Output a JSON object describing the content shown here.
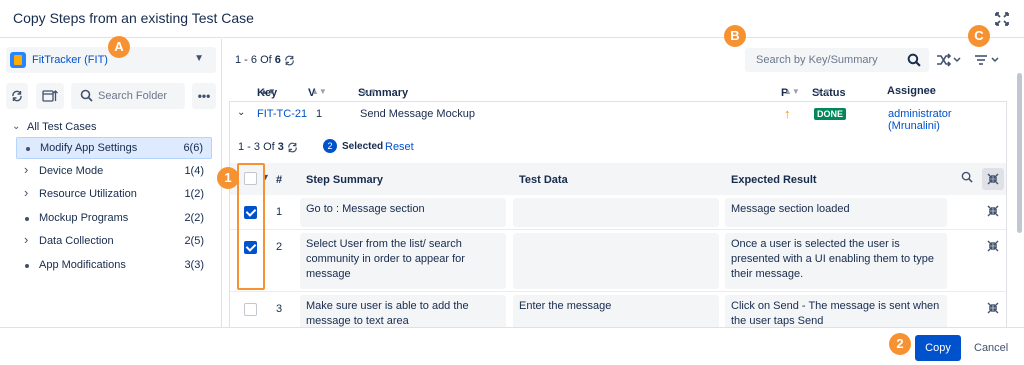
{
  "dialog": {
    "title": "Copy Steps from an existing Test Case"
  },
  "left": {
    "project": "FitTracker (FIT)",
    "folder_search_placeholder": "Search Folder",
    "root": "All Test Cases",
    "folders": [
      {
        "label": "Modify App Settings",
        "count": "6(6)",
        "selected": true,
        "expandable": false
      },
      {
        "label": "Device Mode",
        "count": "1(4)",
        "selected": false,
        "expandable": true
      },
      {
        "label": "Resource Utilization",
        "count": "1(2)",
        "selected": false,
        "expandable": true
      },
      {
        "label": "Mockup Programs",
        "count": "2(2)",
        "selected": false,
        "expandable": false
      },
      {
        "label": "Data Collection",
        "count": "2(5)",
        "selected": false,
        "expandable": true
      },
      {
        "label": "App Modifications",
        "count": "3(3)",
        "selected": false,
        "expandable": false
      }
    ]
  },
  "right": {
    "pager": {
      "prefix": "1 - 6 Of",
      "total": "6"
    },
    "search_placeholder": "Search by Key/Summary",
    "columns": {
      "key": "Key",
      "v": "V",
      "summary": "Summary",
      "p": "P",
      "status": "Status",
      "assignee": "Assignee"
    },
    "testcase": {
      "key": "FIT-TC-21",
      "v": "1",
      "summary": "Send Message Mockup",
      "priority": "↑",
      "status": "DONE",
      "assignee": "administrator (Mrunalini)"
    },
    "steps_pager": {
      "prefix": "1 - 3 Of",
      "total": "3"
    },
    "selected_count": "2",
    "selected_label": "Selected",
    "reset_label": "Reset",
    "step_columns": {
      "num": "#",
      "summary": "Step Summary",
      "data": "Test Data",
      "expected": "Expected Result"
    },
    "steps": [
      {
        "n": "1",
        "checked": true,
        "summary": "Go to : Message section",
        "data": "",
        "expected": "Message section loaded"
      },
      {
        "n": "2",
        "checked": true,
        "summary": "Select User from the list/ search community in order to appear for message",
        "data": "",
        "expected": "Once a user is selected the user is presented with a UI enabling them to type their message."
      },
      {
        "n": "3",
        "checked": false,
        "summary": "Make sure user is able to add the message to text area",
        "data": "Enter the message",
        "expected": "Click on Send - The message is sent when the user taps Send"
      }
    ]
  },
  "footer": {
    "copy": "Copy",
    "cancel": "Cancel"
  },
  "callouts": {
    "a": "A",
    "b": "B",
    "c": "C",
    "one": "1",
    "two": "2"
  },
  "colors": {
    "accent": "#0052cc",
    "callout": "#f79232",
    "done": "#00875a",
    "priority": "#ff8b00"
  }
}
